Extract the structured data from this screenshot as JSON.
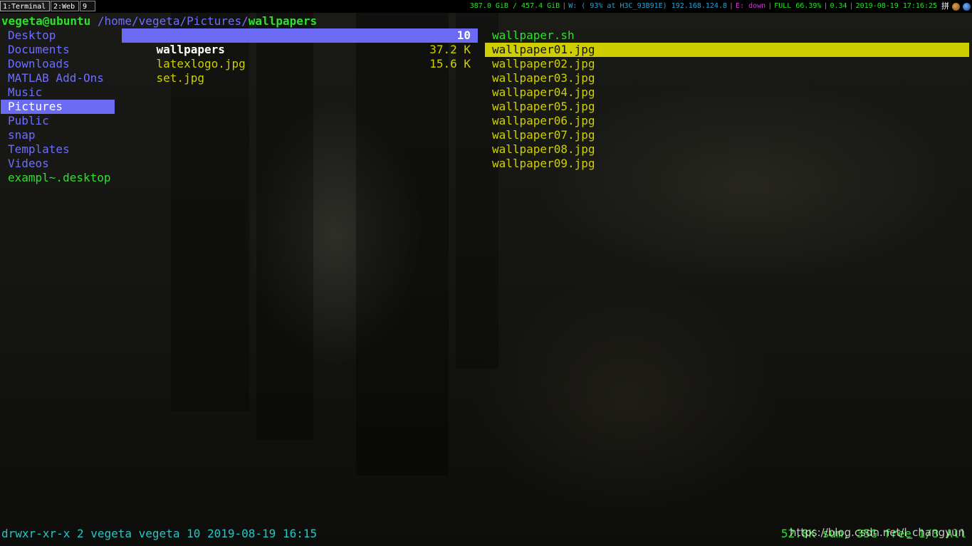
{
  "bar": {
    "workspaces": [
      "1:Terminal",
      "2:Web",
      "9"
    ],
    "status": {
      "disk": "387.0 GiB / 457.4 GiB",
      "wifi": "W: ( 93% at H3C_93B91E) 192.168.124.8",
      "eth": "E: down",
      "battery": "FULL 66.39%",
      "load": "0.34",
      "datetime": "2019-08-19 17:16:25",
      "ime": "拼"
    }
  },
  "ranger": {
    "path": {
      "user_host": "vegeta@ubuntu",
      "dir": "/home/vegeta/Pictures/",
      "current": "wallpapers"
    },
    "parent_dir": [
      {
        "name": "Desktop"
      },
      {
        "name": "Documents"
      },
      {
        "name": "Downloads"
      },
      {
        "name": "MATLAB Add-Ons"
      },
      {
        "name": "Music"
      },
      {
        "name": "Pictures"
      },
      {
        "name": "Public"
      },
      {
        "name": "snap"
      },
      {
        "name": "Templates"
      },
      {
        "name": "Videos"
      },
      {
        "name": "exampl~.desktop"
      }
    ],
    "current_dir": [
      {
        "name": "wallpapers",
        "size": "10"
      },
      {
        "name": "latexlogo.jpg",
        "size": "37.2 K"
      },
      {
        "name": "set.jpg",
        "size": "15.6 K"
      }
    ],
    "preview": [
      {
        "name": "wallpaper.sh"
      },
      {
        "name": "wallpaper01.jpg"
      },
      {
        "name": "wallpaper02.jpg"
      },
      {
        "name": "wallpaper03.jpg"
      },
      {
        "name": "wallpaper04.jpg"
      },
      {
        "name": "wallpaper05.jpg"
      },
      {
        "name": "wallpaper06.jpg"
      },
      {
        "name": "wallpaper07.jpg"
      },
      {
        "name": "wallpaper08.jpg"
      },
      {
        "name": "wallpaper09.jpg"
      }
    ],
    "footer": {
      "info": "drwxr-xr-x 2 vegeta vegeta 10 2019-08-19 16:15",
      "summary": "52.8K sum, 35G free 1/3 All"
    }
  },
  "watermark": "https://blog.csdn.net/l_changyun",
  "colors": {
    "dir": "#6e6eff",
    "exec": "#2ee02e",
    "image": "#d0d000",
    "info": "#27c6c6"
  }
}
